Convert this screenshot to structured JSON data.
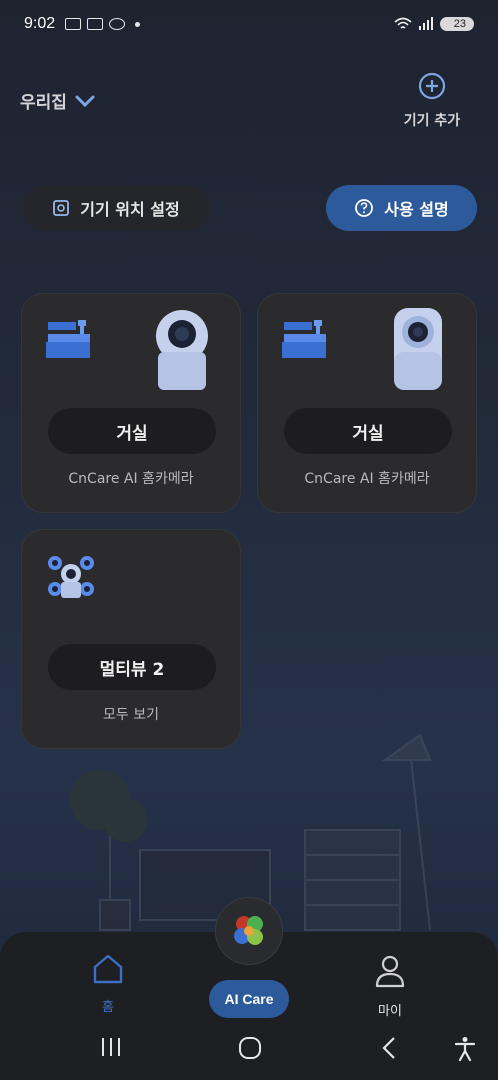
{
  "status": {
    "time": "9:02",
    "battery": "23"
  },
  "header": {
    "home_name": "우리집",
    "add_device_label": "기기 추가"
  },
  "actions": {
    "location_label": "기기 위치 설정",
    "help_label": "사용 설명"
  },
  "devices": [
    {
      "room": "거실",
      "name": "CnCare AI 홈카메라"
    },
    {
      "room": "거실",
      "name": "CnCare AI 홈카메라"
    },
    {
      "room": "멀티뷰 2",
      "name": "모두 보기"
    }
  ],
  "nav": {
    "home_label": "홈",
    "ai_label": "AI Care",
    "my_label": "마이"
  },
  "colors": {
    "accent": "#2d5a9a",
    "card": "#2b2b2d",
    "nav": "#1e1f22"
  }
}
